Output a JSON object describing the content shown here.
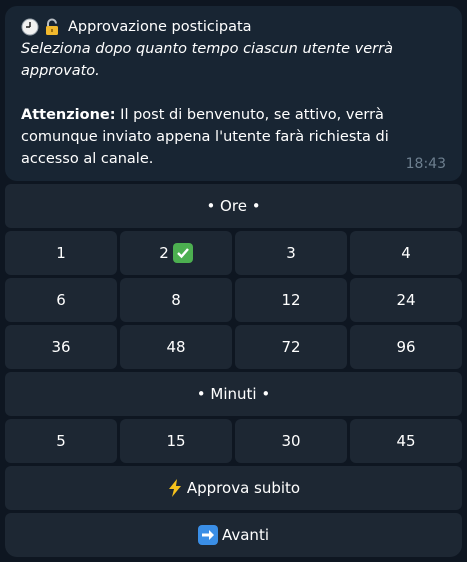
{
  "message": {
    "title": "Approvazione posticipata",
    "subtitle": "Seleziona dopo quanto tempo ciascun utente verrà approvato.",
    "warning_label": "Attenzione:",
    "warning_text": " Il post di benvenuto, se attivo, verrà comunque inviato appena l'utente farà richiesta di accesso al canale.",
    "time": "18:43"
  },
  "keyboard": {
    "hours_header": "• Ore •",
    "hours_row1": [
      "1",
      "2",
      "3",
      "4"
    ],
    "hours_row2": [
      "6",
      "8",
      "12",
      "24"
    ],
    "hours_row3": [
      "36",
      "48",
      "72",
      "96"
    ],
    "minutes_header": "• Minuti •",
    "minutes_row": [
      "5",
      "15",
      "30",
      "45"
    ],
    "approve_label": "Approva subito",
    "next_label": "Avanti"
  },
  "icons": {
    "title_icons": [
      "clock-icon",
      "lock-icon"
    ],
    "selected_icon": "check-icon",
    "approve_icon": "bolt-icon",
    "next_icon": "arrow-right-icon"
  },
  "colors": {
    "background": "#0e1621",
    "bubble": "#182533",
    "button": "#1d2733",
    "time": "#6d7f8f",
    "check": "#4caf50"
  }
}
